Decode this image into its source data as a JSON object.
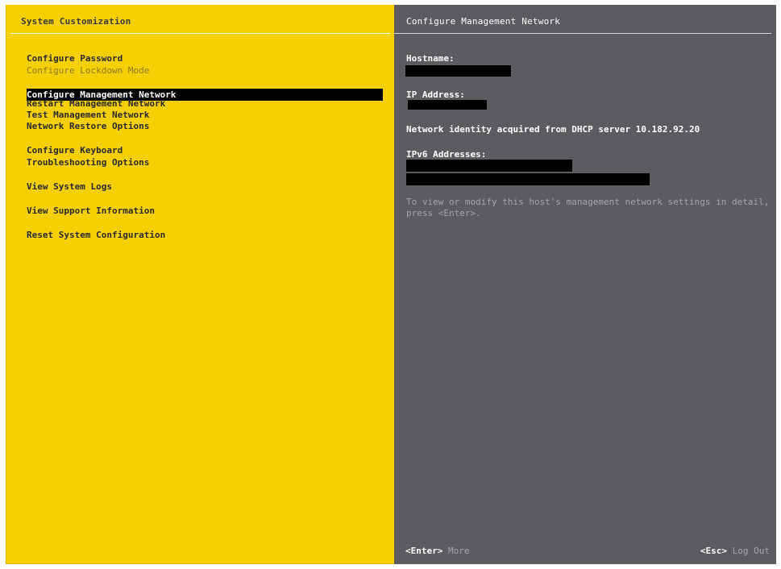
{
  "left_pane": {
    "title": "System Customization",
    "menu": [
      {
        "label": "Configure Password",
        "state": "normal"
      },
      {
        "label": "Configure Lockdown Mode",
        "state": "disabled"
      },
      {
        "label": "Configure Management Network",
        "state": "selected"
      },
      {
        "label": "Restart Management Network",
        "state": "normal"
      },
      {
        "label": "Test Management Network",
        "state": "normal"
      },
      {
        "label": "Network Restore Options",
        "state": "normal"
      },
      {
        "label": "Configure Keyboard",
        "state": "normal"
      },
      {
        "label": "Troubleshooting Options",
        "state": "normal"
      },
      {
        "label": "View System Logs",
        "state": "normal"
      },
      {
        "label": "View Support Information",
        "state": "normal"
      },
      {
        "label": "Reset System Configuration",
        "state": "normal"
      }
    ]
  },
  "right_pane": {
    "title": "Configure Management Network",
    "hostname_label": "Hostname:",
    "ip_label": "IP Address:",
    "dhcp_text": "Network identity acquired from DHCP server 10.182.92.20",
    "ipv6_label": "IPv6 Addresses:",
    "hint": "To view or modify this host's management network settings in detail, press <Enter>.",
    "footer": {
      "enter_key": "<Enter>",
      "enter_action": "More",
      "esc_key": "<Esc>",
      "esc_action": "Log Out"
    }
  },
  "colors": {
    "left_background": "#f6cf05",
    "right_background": "#5c5b60",
    "selection": "#000000",
    "redaction": "#000000"
  }
}
